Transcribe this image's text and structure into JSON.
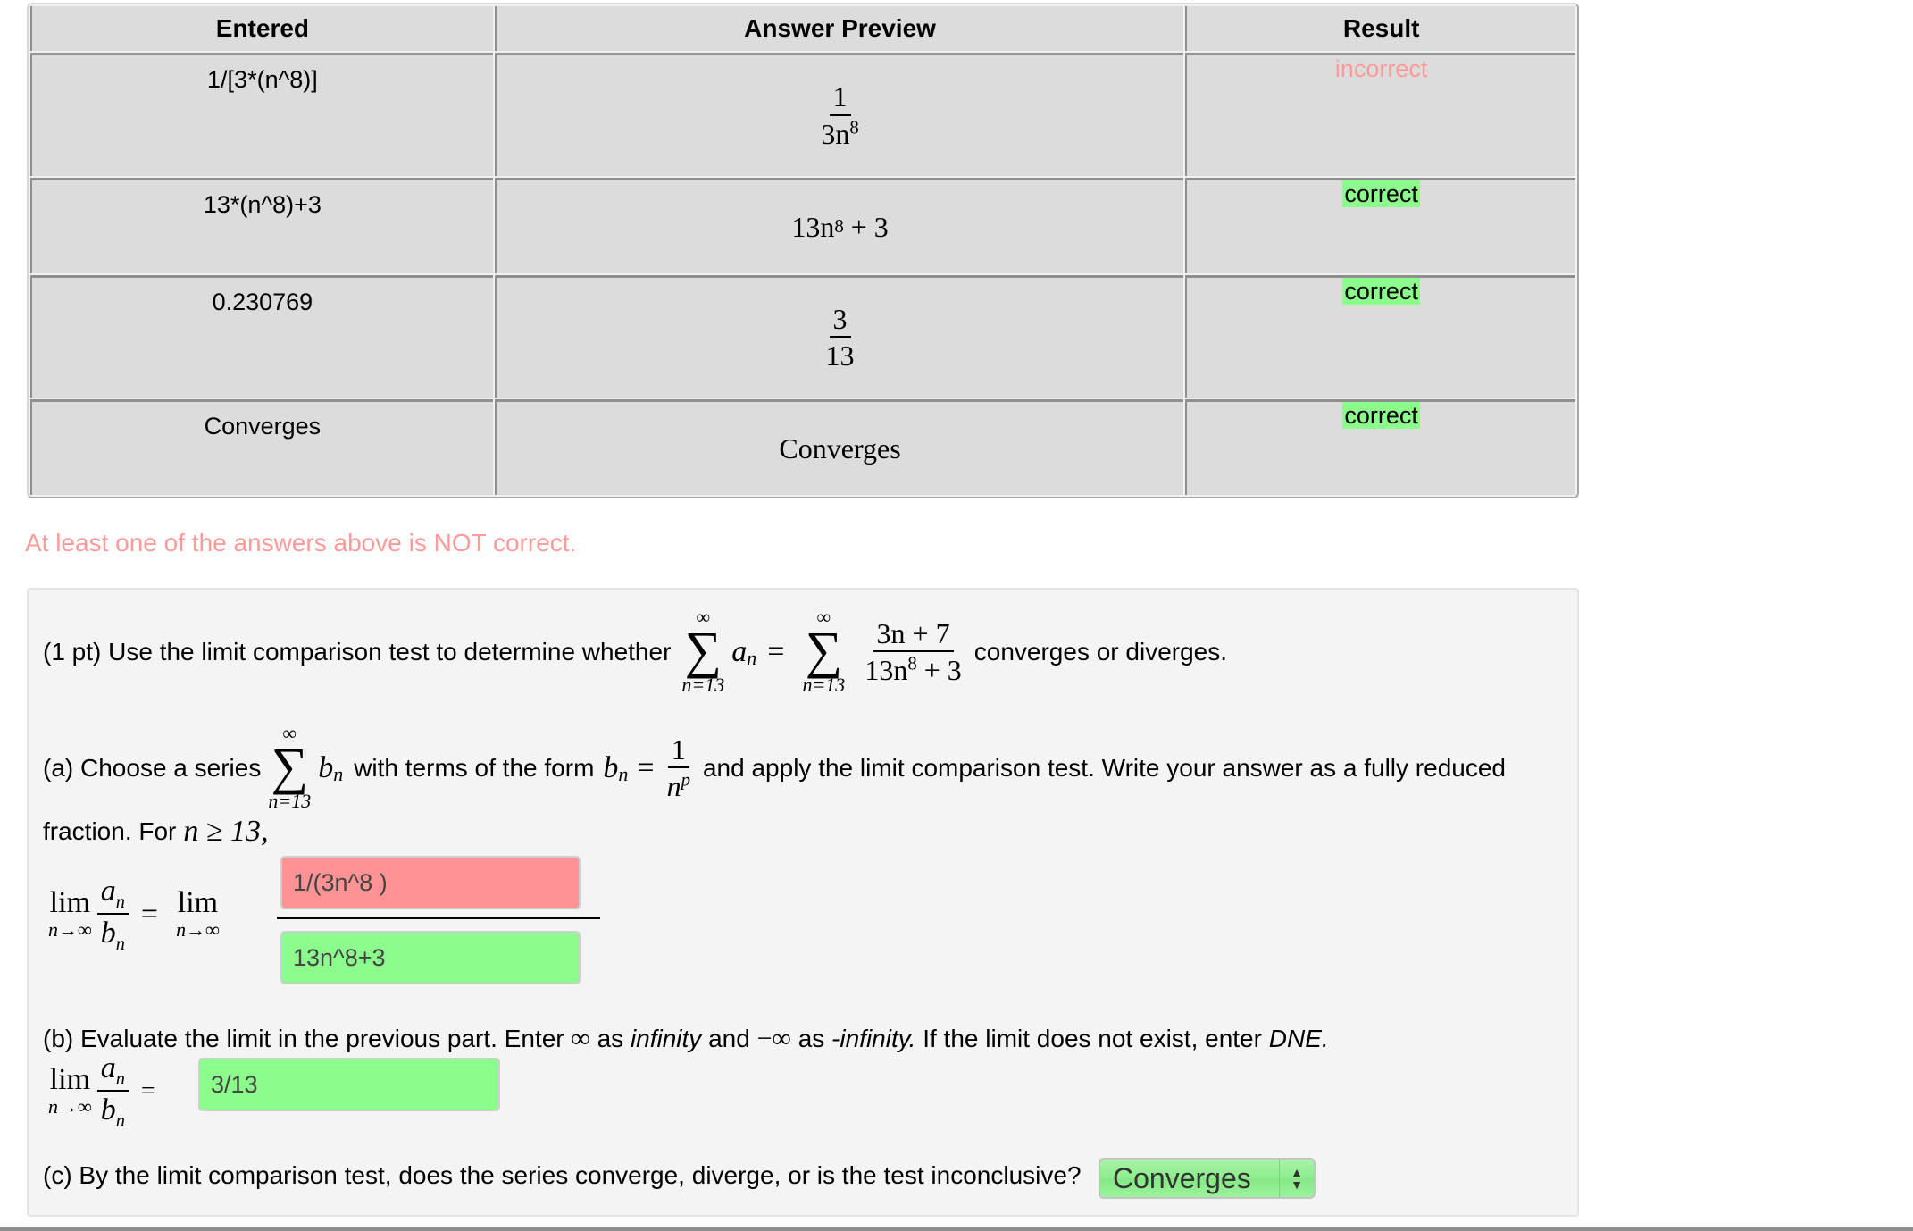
{
  "results_table": {
    "headers": [
      "Entered",
      "Answer Preview",
      "Result"
    ],
    "rows": [
      {
        "entered": "1/[3*(n^8)]",
        "preview": {
          "type": "fraction",
          "num": "1",
          "den_base": "3n",
          "den_sup": "8"
        },
        "result": "incorrect"
      },
      {
        "entered": "13*(n^8)+3",
        "preview": {
          "type": "expr",
          "base": "13n",
          "sup": "8",
          "rest": " + 3"
        },
        "result": "correct"
      },
      {
        "entered": "0.230769",
        "preview": {
          "type": "fraction",
          "num": "3",
          "den": "13"
        },
        "result": "correct"
      },
      {
        "entered": "Converges",
        "preview": {
          "type": "text",
          "text": "Converges"
        },
        "result": "correct"
      }
    ]
  },
  "warning": "At least one of the answers above is NOT correct.",
  "problem": {
    "intro": "(1 pt) Use the limit comparison test to determine whether",
    "sum_upper": "∞",
    "sum_lower": "n=13",
    "a_n": "a",
    "a_sub": "n",
    "eq": "=",
    "series_num": "3n + 7",
    "series_den_base": "13n",
    "series_den_sup": "8",
    "series_den_rest": " + 3",
    "outro": "converges or diverges.",
    "part_a": {
      "text1": "(a) Choose a series",
      "b": "b",
      "b_sub": "n",
      "text2": "with terms of the form",
      "frac_num": "1",
      "frac_den": "n",
      "frac_den_sup": "p",
      "text3": "and apply the limit comparison test. Write your answer as a fully reduced",
      "text4": "fraction. For",
      "cond": "n ≥ 13,",
      "lim": "lim",
      "lim_sub": "n→∞",
      "numerator_value": "1/(3n^8 )",
      "denominator_value": "13n^8+3"
    },
    "part_b": {
      "text1": "(b) Evaluate the limit in the previous part. Enter",
      "inf": "∞",
      "as1": "as",
      "infinity": "infinity",
      "and": "and",
      "neg_inf": "−∞",
      "as2": "as",
      "neg_infinity": "-infinity.",
      "text2": "If the limit does not exist, enter",
      "dne": "DNE.",
      "value": "3/13"
    },
    "part_c": {
      "text": "(c) By the limit comparison test, does the series converge, diverge, or is the test inconclusive?",
      "selected": "Converges"
    }
  },
  "colors": {
    "correct": "#8cfc8c",
    "incorrect_text": "#ff9a9a",
    "incorrect_input": "#ff9393"
  }
}
